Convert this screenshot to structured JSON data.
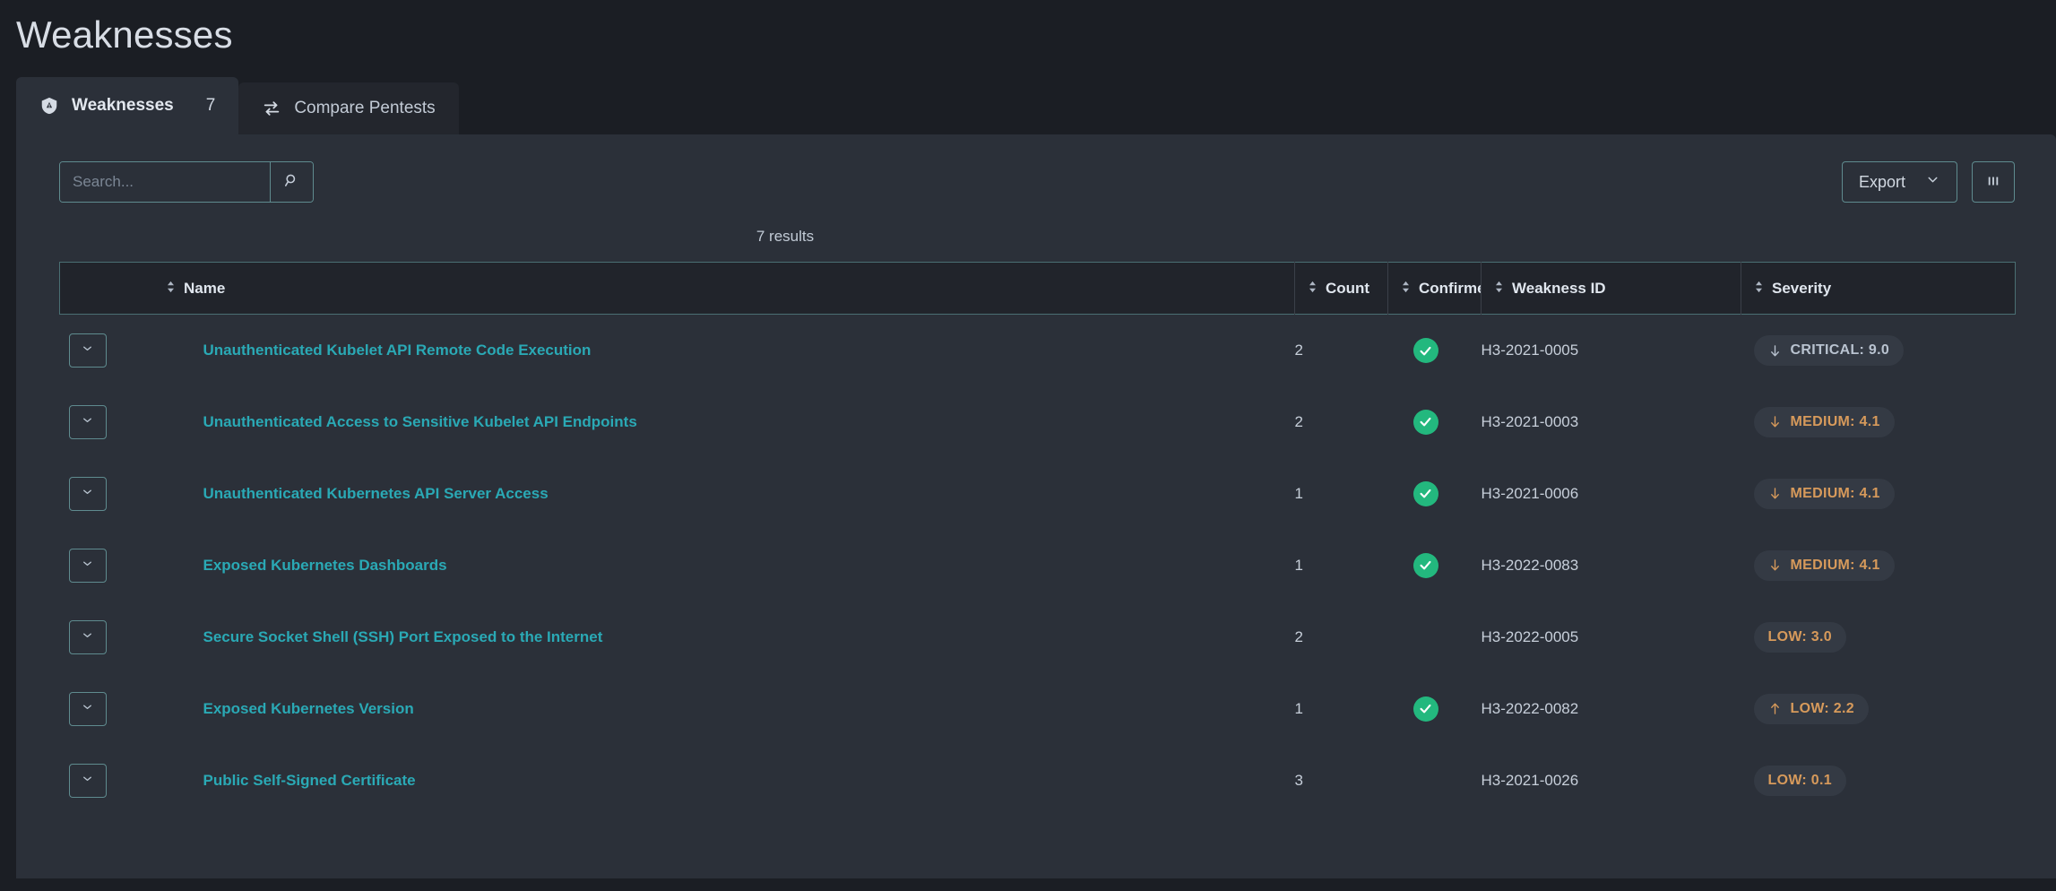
{
  "page": {
    "title": "Weaknesses"
  },
  "tabs": [
    {
      "label": "Weaknesses",
      "count": "7",
      "icon": "shield-warning-icon",
      "active": true
    },
    {
      "label": "Compare Pentests",
      "count": "",
      "icon": "compare-arrows-icon",
      "active": false
    }
  ],
  "toolbar": {
    "search_placeholder": "Search...",
    "search_value": "",
    "search_icon": "search-icon",
    "export_label": "Export",
    "export_caret_icon": "chevron-down-icon",
    "columns_icon": "columns-icon"
  },
  "results": {
    "text": "7 results"
  },
  "table": {
    "columns": [
      {
        "key": "name",
        "label": "Name",
        "sortable": true
      },
      {
        "key": "count",
        "label": "Count",
        "sortable": true
      },
      {
        "key": "confirmed",
        "label": "Confirmed",
        "sortable": true
      },
      {
        "key": "weakness_id",
        "label": "Weakness ID",
        "sortable": true
      },
      {
        "key": "severity",
        "label": "Severity",
        "sortable": true
      }
    ],
    "rows": [
      {
        "name": "Unauthenticated Kubelet API Remote Code Execution",
        "count": "2",
        "confirmed": true,
        "weakness_id": "H3-2021-0005",
        "severity_label": "CRITICAL: 9.0",
        "severity_level": "critical",
        "severity_trend": "down"
      },
      {
        "name": "Unauthenticated Access to Sensitive Kubelet API Endpoints",
        "count": "2",
        "confirmed": true,
        "weakness_id": "H3-2021-0003",
        "severity_label": "MEDIUM: 4.1",
        "severity_level": "medium",
        "severity_trend": "down"
      },
      {
        "name": "Unauthenticated Kubernetes API Server Access",
        "count": "1",
        "confirmed": true,
        "weakness_id": "H3-2021-0006",
        "severity_label": "MEDIUM: 4.1",
        "severity_level": "medium",
        "severity_trend": "down"
      },
      {
        "name": "Exposed Kubernetes Dashboards",
        "count": "1",
        "confirmed": true,
        "weakness_id": "H3-2022-0083",
        "severity_label": "MEDIUM: 4.1",
        "severity_level": "medium",
        "severity_trend": "down"
      },
      {
        "name": "Secure Socket Shell (SSH) Port Exposed to the Internet",
        "count": "2",
        "confirmed": false,
        "weakness_id": "H3-2022-0005",
        "severity_label": "LOW: 3.0",
        "severity_level": "low",
        "severity_trend": "none"
      },
      {
        "name": "Exposed Kubernetes Version",
        "count": "1",
        "confirmed": true,
        "weakness_id": "H3-2022-0082",
        "severity_label": "LOW: 2.2",
        "severity_level": "low",
        "severity_trend": "up"
      },
      {
        "name": "Public Self-Signed Certificate",
        "count": "3",
        "confirmed": false,
        "weakness_id": "H3-2021-0026",
        "severity_label": "LOW: 0.1",
        "severity_level": "low",
        "severity_trend": "none"
      }
    ],
    "row_expand_icon": "chevron-down-icon",
    "sort_icon": "sort-updown-icon",
    "confirmed_icon": "check-circle-icon"
  },
  "colors": {
    "page_bg": "#1b1e24",
    "panel_bg": "#2b3039",
    "link": "#2aa9b5",
    "accent_border": "#5f8b8f",
    "confirmed_green": "#23b87e",
    "severity_orange": "#d79a5b",
    "severity_critical": "#b9c3d0",
    "badge_bg": "#343a44"
  }
}
